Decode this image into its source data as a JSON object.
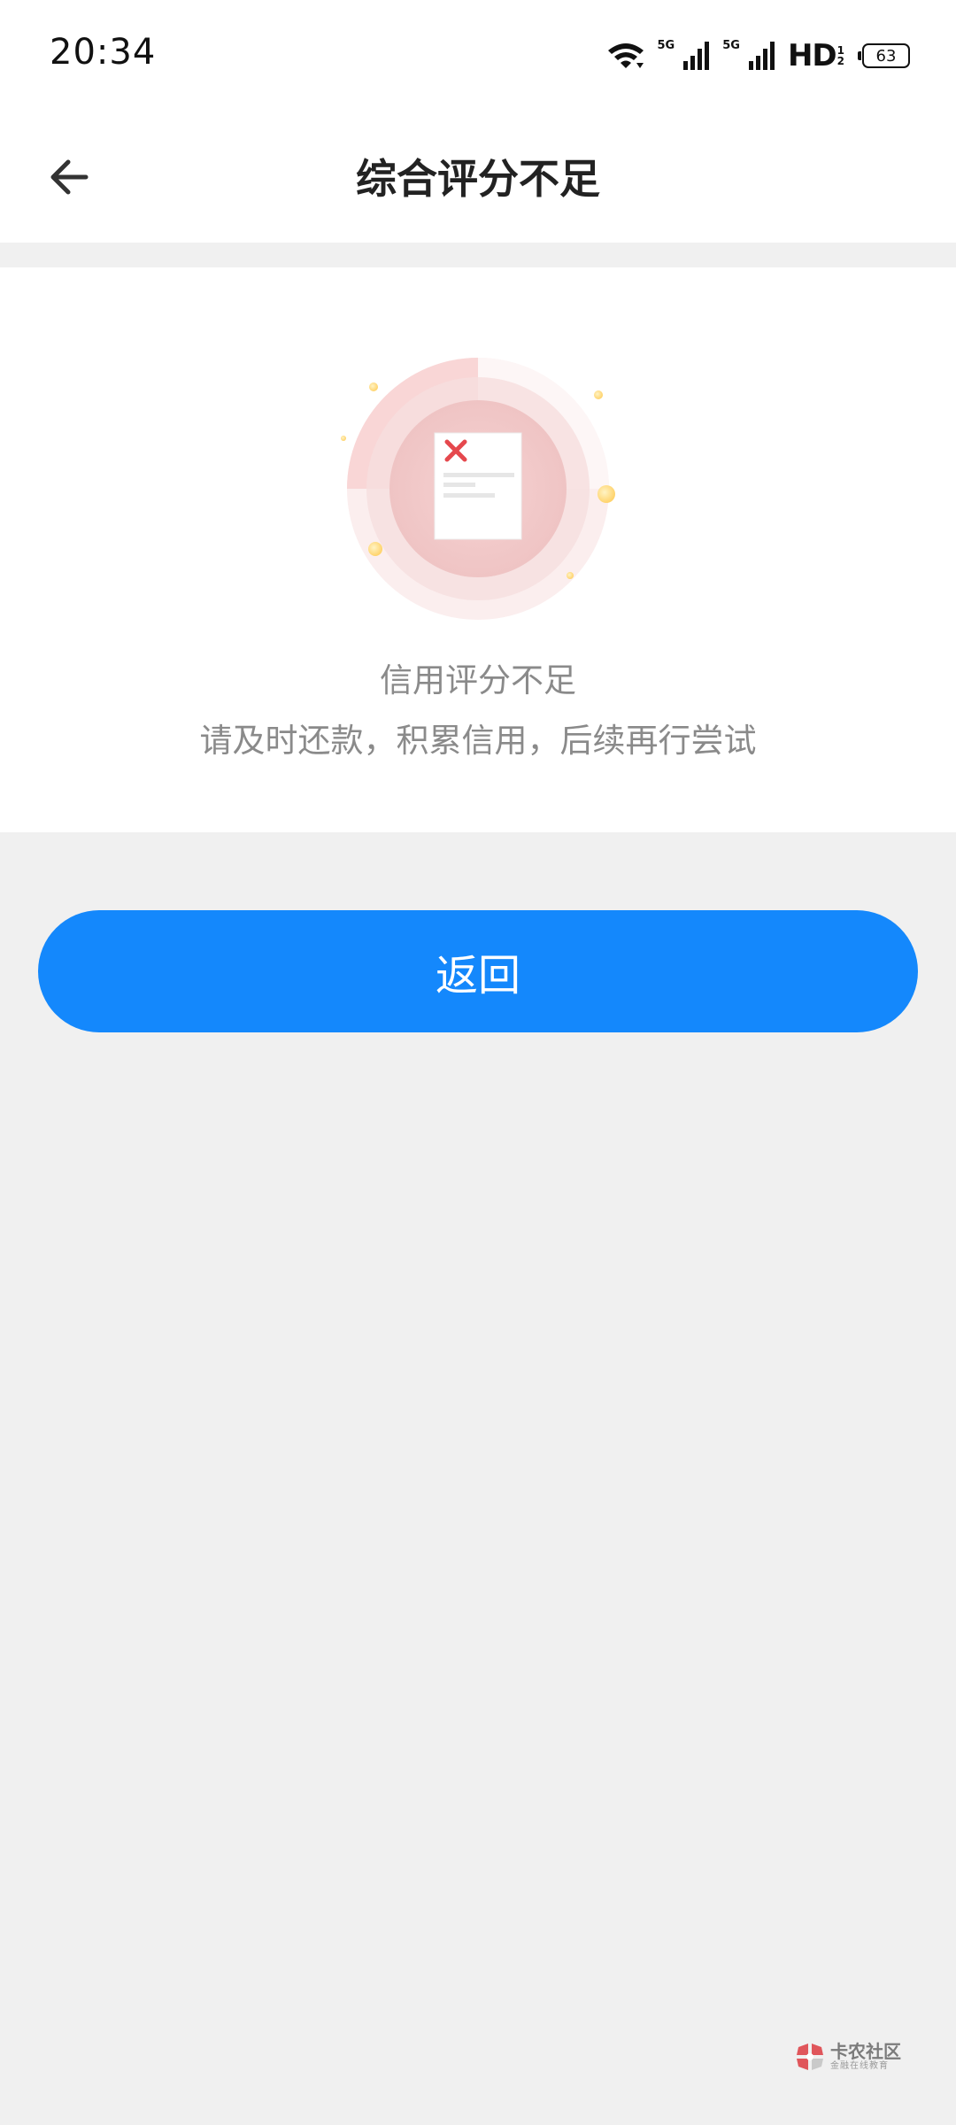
{
  "status_bar": {
    "time": "20:34",
    "network_1": "5G",
    "network_2": "5G",
    "hd": "HD",
    "hd_sub_top": "1",
    "hd_sub_bottom": "2",
    "battery": "63"
  },
  "header": {
    "title": "综合评分不足"
  },
  "result": {
    "title": "信用评分不足",
    "description": "请及时还款，积累信用，后续再行尝试"
  },
  "actions": {
    "return_label": "返回"
  },
  "watermark": {
    "name": "卡农社区",
    "subtitle": "金融在线教育"
  },
  "colors": {
    "primary": "#1488fc",
    "error_red": "#e5484d",
    "background": "#f0f0f0"
  }
}
